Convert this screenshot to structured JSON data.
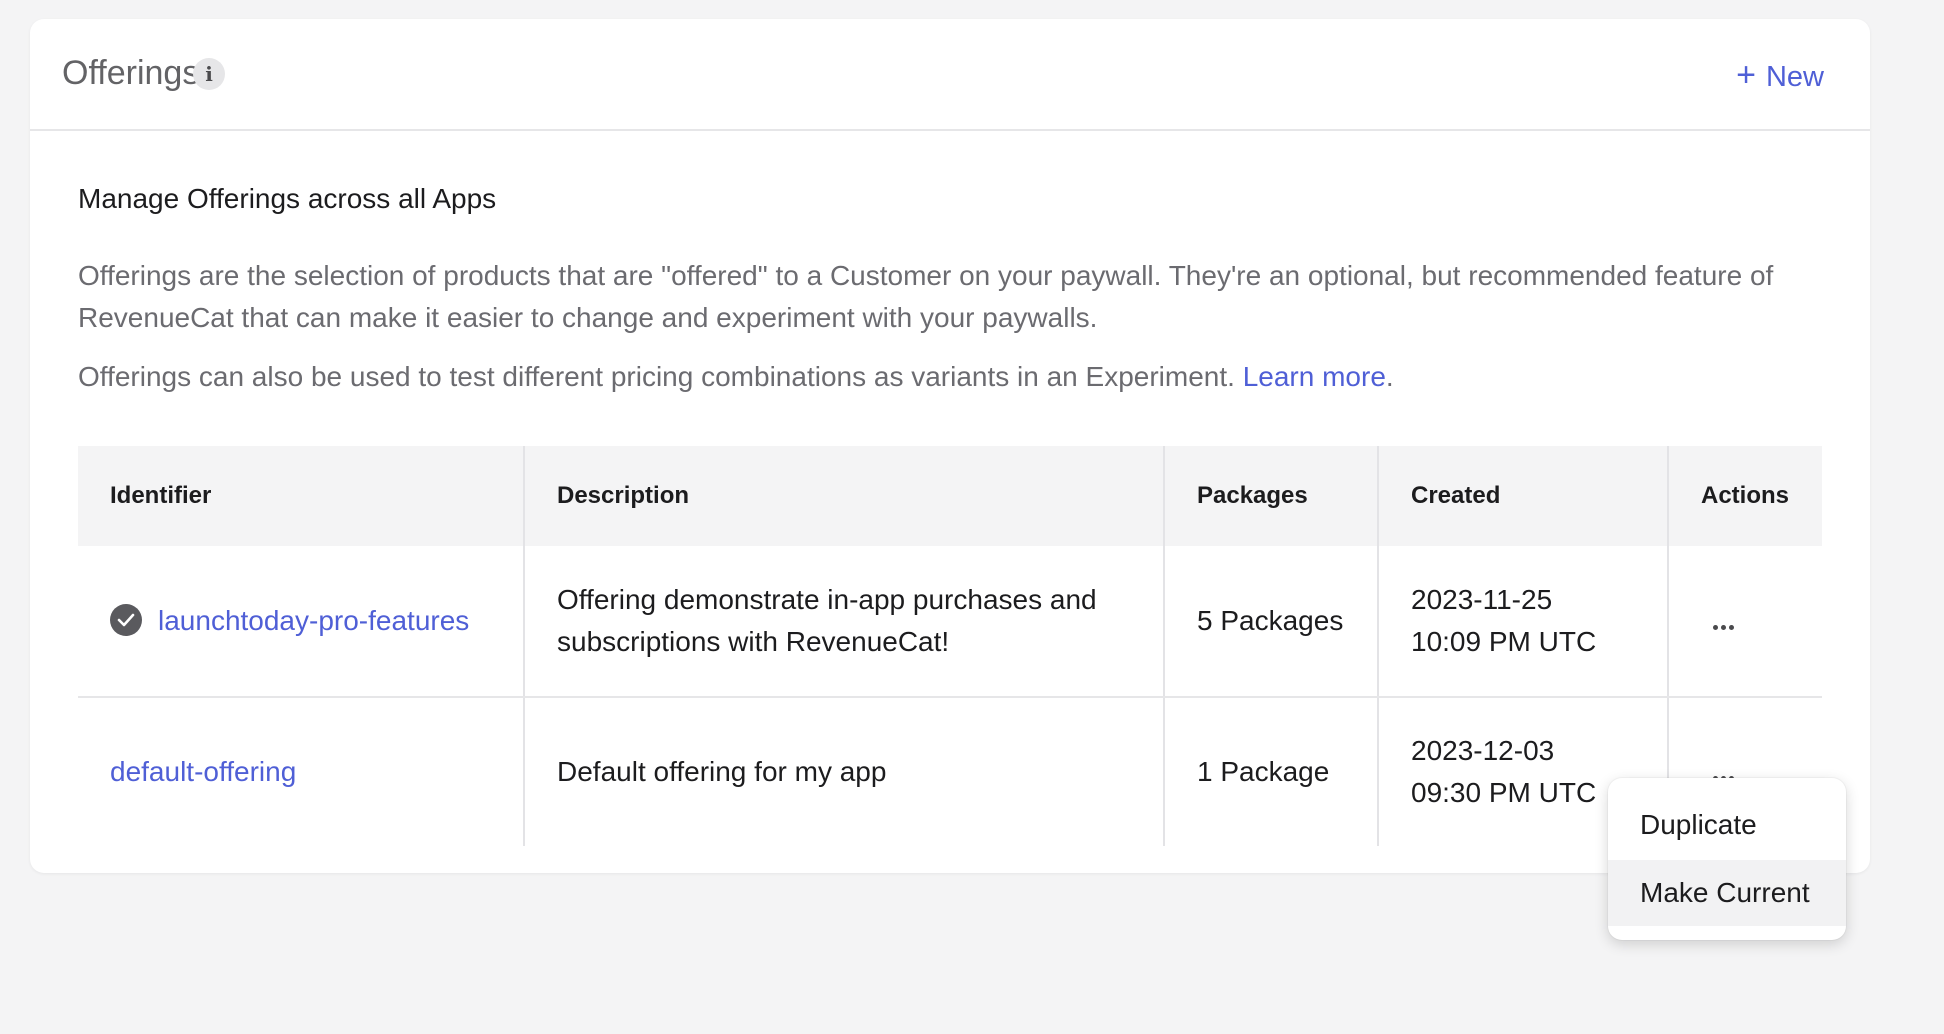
{
  "header": {
    "title": "Offerings",
    "info_icon": "i",
    "new_button_icon": "+",
    "new_button_label": "New"
  },
  "intro": {
    "heading": "Manage Offerings across all Apps",
    "paragraph1": "Offerings are the selection of products that are \"offered\" to a Customer on your paywall. They're an optional, but recommended feature of RevenueCat that can make it easier to change and experiment with your paywalls.",
    "paragraph2_text": "Offerings can also be used to test different pricing combinations as variants in an Experiment. ",
    "learn_more": "Learn more",
    "paragraph2_end": "."
  },
  "table": {
    "columns": [
      "Identifier",
      "Description",
      "Packages",
      "Created",
      "Actions"
    ],
    "rows": [
      {
        "identifier": "launchtoday-pro-features",
        "is_current": true,
        "description": "Offering demonstrate in-app purchases and subscriptions with RevenueCat!",
        "packages": "5 Packages",
        "created_date": "2023-11-25",
        "created_time": "10:09 PM UTC"
      },
      {
        "identifier": "default-offering",
        "is_current": false,
        "description": "Default offering for my app",
        "packages": "1 Package",
        "created_date": "2023-12-03",
        "created_time": "09:30 PM UTC"
      }
    ]
  },
  "actions_menu": {
    "items": [
      "Duplicate",
      "Make Current"
    ],
    "highlighted": "Make Current"
  },
  "colors": {
    "accent": "#4f5fd6",
    "background": "#f4f4f5",
    "card": "#ffffff"
  }
}
